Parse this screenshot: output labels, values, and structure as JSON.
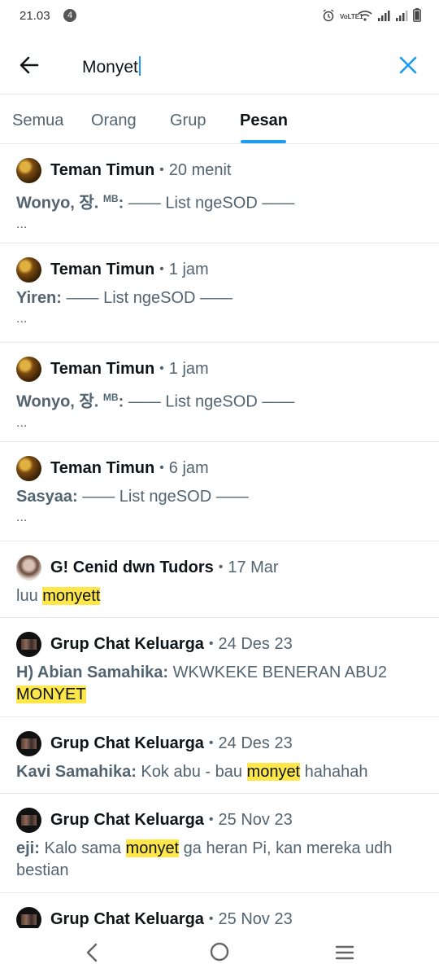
{
  "status": {
    "time": "21.03",
    "notification_count": "4",
    "network_label": "VoLTE1"
  },
  "search": {
    "value": "Monyet"
  },
  "tabs": [
    {
      "label": "Semua",
      "active": false
    },
    {
      "label": "Orang",
      "active": false
    },
    {
      "label": "Grup",
      "active": false
    },
    {
      "label": "Pesan",
      "active": true
    }
  ],
  "results": [
    {
      "group": "Teman Timun",
      "dot": "•",
      "time": "20 menit",
      "sender": "Wonyo, 장.",
      "sender_sup": "MB",
      "colon": ":",
      "text": " —— List ngeSOD ——",
      "more": "..."
    },
    {
      "group": "Teman Timun",
      "dot": "•",
      "time": "1 jam",
      "sender": "Yiren",
      "colon": ":",
      "text": " —— List ngeSOD ——",
      "more": "..."
    },
    {
      "group": "Teman Timun",
      "dot": "•",
      "time": "1 jam",
      "sender": "Wonyo, 장.",
      "sender_sup": "MB",
      "colon": ":",
      "text": " —— List ngeSOD ——",
      "more": "..."
    },
    {
      "group": "Teman Timun",
      "dot": "•",
      "time": "6 jam",
      "sender": "Sasyaa",
      "colon": ":",
      "text": " —— List ngeSOD ——",
      "more": "..."
    },
    {
      "group": "G! Cenid dwn Tudors",
      "dot": "•",
      "time": "17 Mar",
      "text_before": "luu ",
      "highlight": "monyett",
      "text_after": ""
    },
    {
      "group": "Grup Chat Keluarga",
      "dot": "•",
      "time": "24 Des 23",
      "sender": "H) Abian Samahika",
      "colon": ":",
      "text_before": " WKWKEKE BENERAN ABU2 ",
      "highlight": "MONYET",
      "text_after": ""
    },
    {
      "group": "Grup Chat Keluarga",
      "dot": "•",
      "time": "24 Des 23",
      "sender": "Kavi Samahika",
      "colon": ":",
      "text_before": " Kok abu - bau ",
      "highlight": "monyet",
      "text_after": " hahahah"
    },
    {
      "group": "Grup Chat Keluarga",
      "dot": "•",
      "time": "25 Nov 23",
      "sender": "eji",
      "colon": ":",
      "text_before": " Kalo sama ",
      "highlight": "monyet",
      "text_after": " ga heran Pi, kan mereka udh bestian"
    },
    {
      "group": "Grup Chat Keluarga",
      "dot": "•",
      "time": "25 Nov 23"
    }
  ],
  "colors": {
    "accent": "#1d9bf0",
    "highlight": "#ffe74a",
    "secondary_text": "#536471"
  }
}
